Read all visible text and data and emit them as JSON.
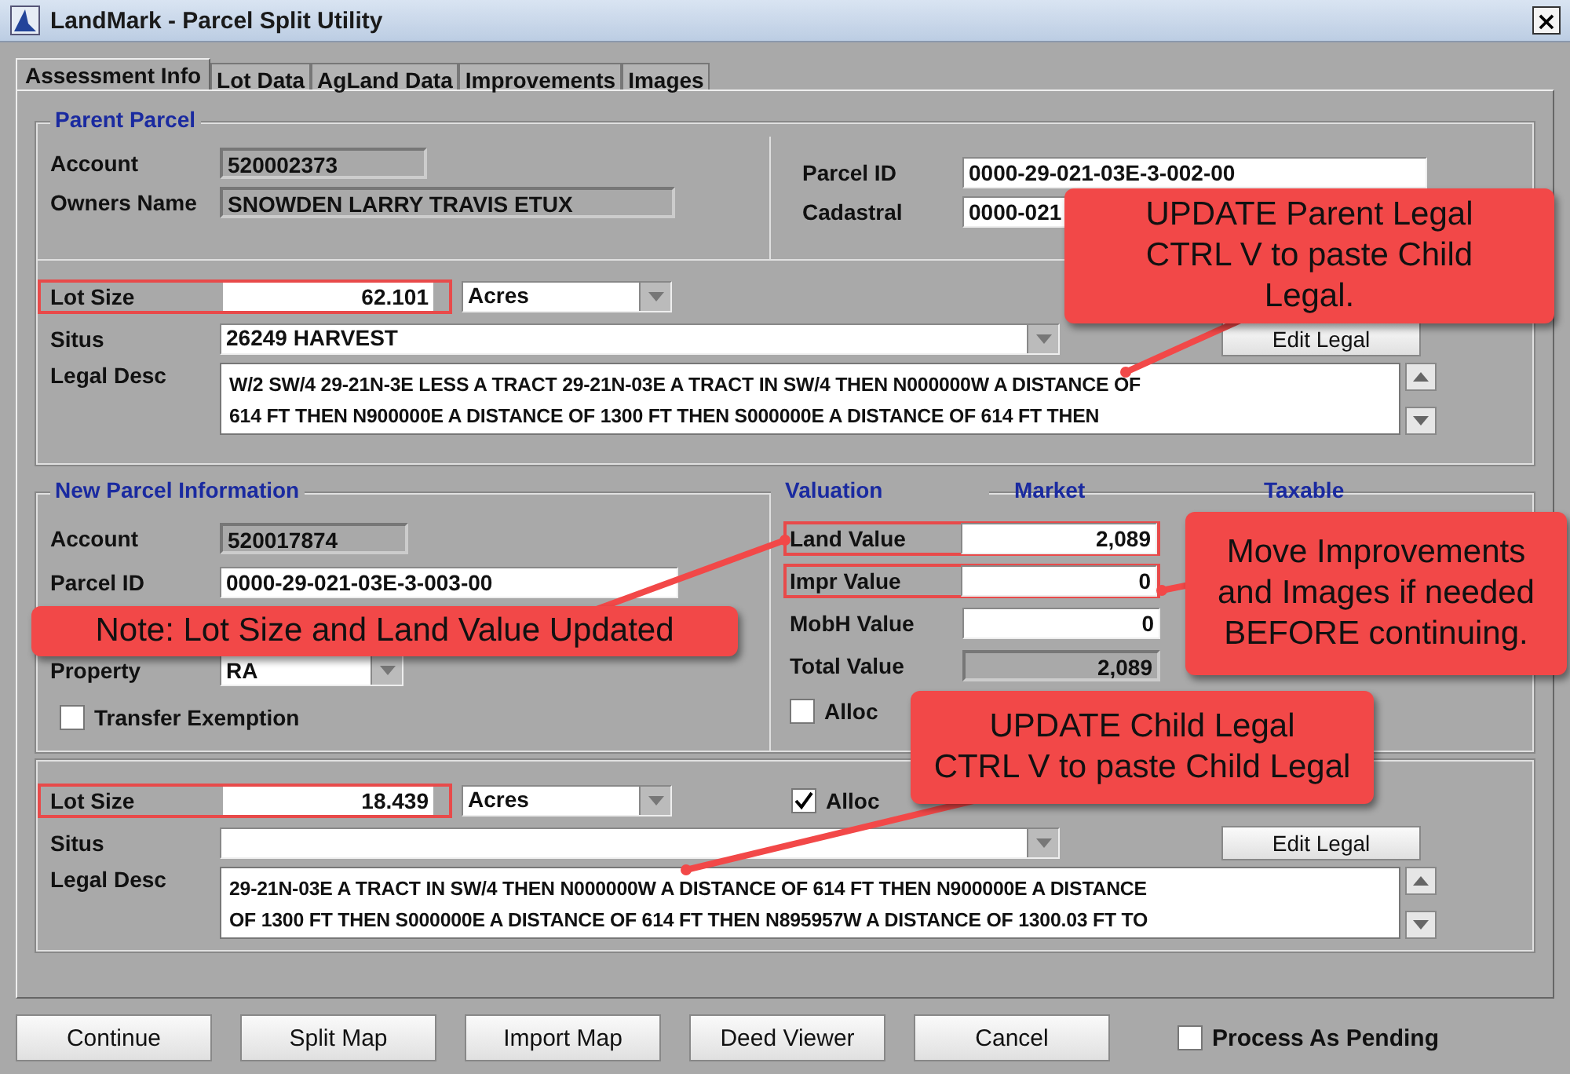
{
  "window": {
    "title": "LandMark - Parcel Split Utility",
    "close": "×"
  },
  "tabs": [
    {
      "label": "Assessment Info",
      "selected": true
    },
    {
      "label": "Lot Data",
      "selected": false
    },
    {
      "label": "AgLand Data",
      "selected": false
    },
    {
      "label": "Improvements",
      "selected": false
    },
    {
      "label": "Images",
      "selected": false
    }
  ],
  "parent_parcel": {
    "title": "Parent Parcel",
    "left_fields": [
      {
        "label": "Account",
        "value": "520002373",
        "readonly": true
      },
      {
        "label": "Owners Name",
        "value": "SNOWDEN LARRY TRAVIS ETUX",
        "readonly": true
      }
    ],
    "right_fields": [
      {
        "label": "Parcel ID",
        "value": "0000-29-021-03E-3-002-00",
        "readonly": false
      },
      {
        "label": "Cadastral",
        "value": "0000-021",
        "readonly": false
      }
    ],
    "lot_size": {
      "label": "Lot Size",
      "value": "62.101",
      "unit": "Acres",
      "highlighted": true
    },
    "situs": {
      "label": "Situs",
      "value": "26249 HARVEST"
    },
    "edit_button": "Edit Legal",
    "legal": {
      "label": "Legal Desc",
      "lines": [
        "W/2 SW/4 29-21N-3E LESS A TRACT 29-21N-03E A TRACT IN SW/4   THEN N000000W A DISTANCE OF",
        "614 FT THEN N900000E A DISTANCE OF 1300 FT THEN S000000E A DISTANCE OF 614 FT THEN"
      ]
    }
  },
  "new_parcel": {
    "title": "New Parcel Information",
    "fields": [
      {
        "label": "Account",
        "value": "520017874",
        "kind": "readonly"
      },
      {
        "label": "Parcel ID",
        "value": "0000-29-021-03E-3-003-00",
        "kind": "text"
      },
      {
        "label": "Property",
        "value": "RA",
        "kind": "combo"
      }
    ],
    "transfer_exemption": {
      "label": "Transfer Exemption",
      "checked": false
    }
  },
  "valuation": {
    "title": "Valuation",
    "columns": [
      "Market",
      "Taxable"
    ],
    "rows": [
      {
        "label": "Land Value",
        "market": "2,089",
        "readonly": false,
        "highlighted": true
      },
      {
        "label": "Impr Value",
        "market": "0",
        "readonly": false,
        "highlighted": true
      },
      {
        "label": "MobH Value",
        "market": "0",
        "readonly": false,
        "highlighted": false
      },
      {
        "label": "Total Value",
        "market": "2,089",
        "readonly": true,
        "highlighted": false
      }
    ],
    "alloc": {
      "label": "Alloc",
      "checked": false
    }
  },
  "child_parcel": {
    "lot_size": {
      "label": "Lot Size",
      "value": "18.439",
      "unit": "Acres",
      "highlighted": true
    },
    "alloc": {
      "label": "Alloc",
      "checked": true
    },
    "situs": {
      "label": "Situs"
    },
    "edit_button": "Edit Legal",
    "legal": {
      "label": "Legal Desc",
      "lines": [
        "29-21N-03E A TRACT IN SW/4   THEN N000000W A DISTANCE OF 614 FT THEN N900000E A DISTANCE",
        "OF 1300 FT THEN S000000E A DISTANCE OF 614 FT THEN N895957W A DISTANCE OF 1300.03 FT TO"
      ]
    }
  },
  "buttons": [
    "Continue",
    "Split Map",
    "Import Map",
    "Deed Viewer",
    "Cancel"
  ],
  "process_as_pending": {
    "label": "Process As Pending",
    "checked": false
  },
  "callouts": [
    {
      "lines": [
        "UPDATE Parent Legal",
        "CTRL V to paste Child",
        "Legal."
      ]
    },
    {
      "lines": [
        "Note: Lot Size and Land Value Updated"
      ]
    },
    {
      "lines": [
        "Move Improvements",
        "and Images if needed",
        "BEFORE continuing."
      ]
    },
    {
      "lines": [
        "UPDATE Child Legal",
        "CTRL V to paste Child Legal"
      ]
    }
  ]
}
